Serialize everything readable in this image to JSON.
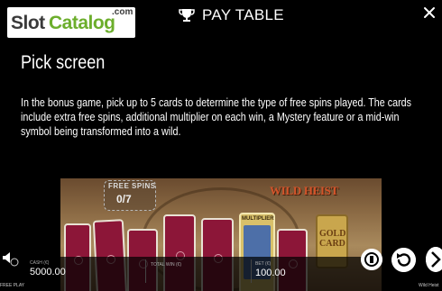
{
  "header": {
    "logo_slot": "Slot",
    "logo_catalog": "Catalog",
    "logo_com": ".com",
    "title": "PAY TABLE",
    "icons": {
      "trophy": "trophy-icon",
      "close": "close-icon"
    }
  },
  "section": {
    "heading": "Pick screen",
    "description": "In the bonus game, pick up to 5 cards to determine the type of free spins played. The cards include extra free spins, additional multiplier on each win, a Mystery feature or a mid-win symbol being transformed into a wild."
  },
  "game_image": {
    "free_spins_label": "FREE SPINS",
    "free_spins_count": "0/7",
    "logo_text": "WILD HEIST",
    "multiplier_label": "MULTIPLIER",
    "gold_card_label": "GOLD CARD"
  },
  "bottom_bar": {
    "cash_label": "CASH (€)",
    "cash_value": "5000.00",
    "total_win_label": "TOTAL WIN (€)",
    "bet_label": "BET (€)",
    "bet_value": "100.00",
    "mode": "FREE PLAY",
    "game_name": "Wild Heist"
  },
  "colors": {
    "background": "#000000",
    "logo_green": "#6cae2c",
    "card_red": "#8c1638"
  }
}
